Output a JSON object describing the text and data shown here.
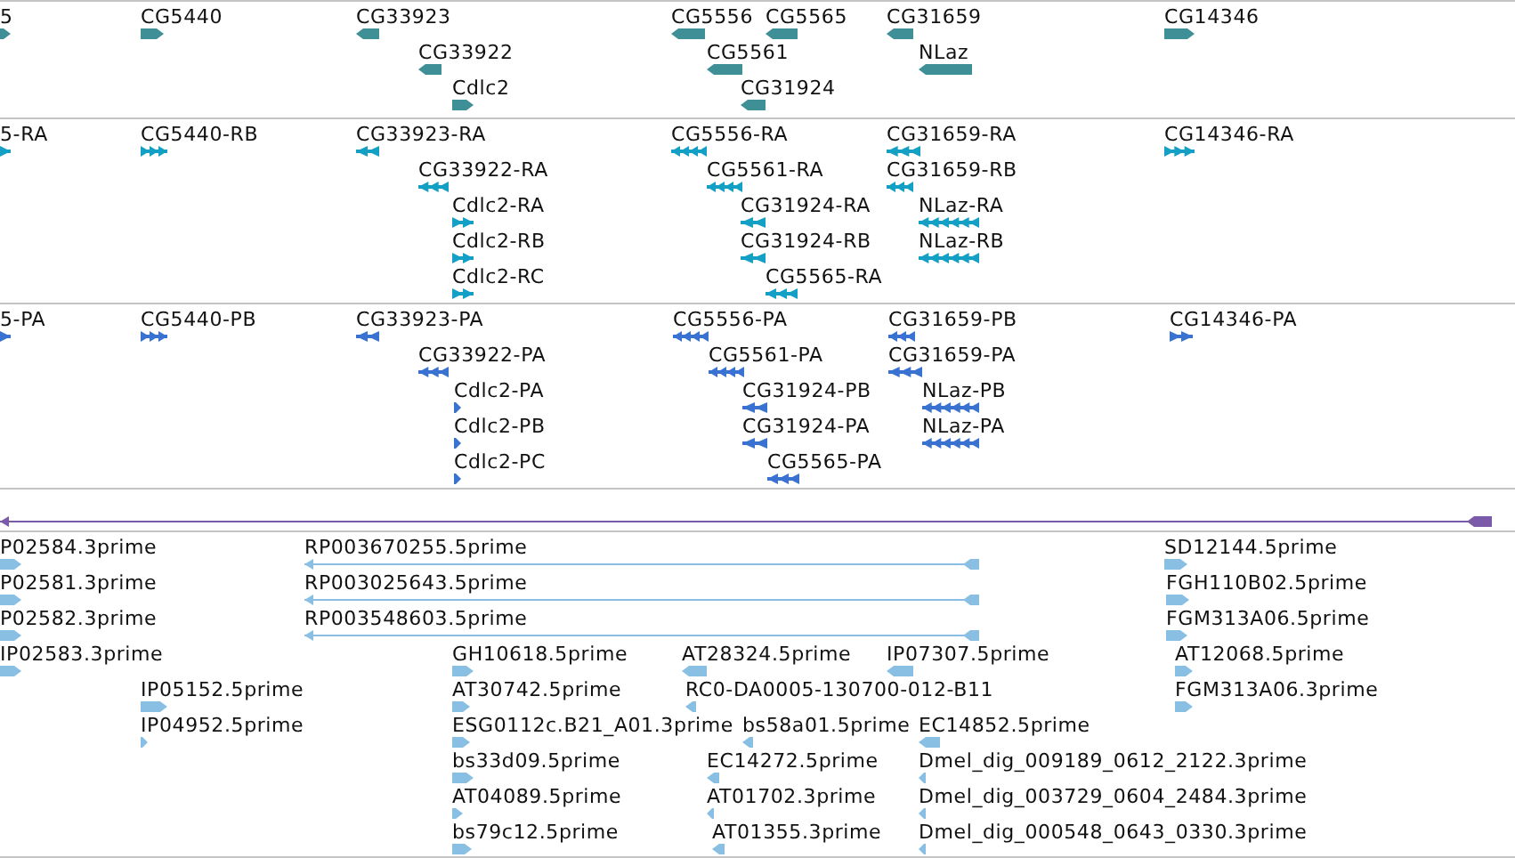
{
  "tracks": [
    {
      "kind": "gene",
      "features": [
        {
          "label": "5",
          "forward": true
        },
        {
          "label": "CG5440",
          "forward": true
        },
        {
          "label": "CG33923",
          "forward": false
        },
        {
          "label": "CG5556",
          "forward": false
        },
        {
          "label": "CG5565",
          "forward": false
        },
        {
          "label": "CG31659",
          "forward": false
        },
        {
          "label": "CG14346",
          "forward": true
        },
        {
          "label": "CG33922",
          "forward": false
        },
        {
          "label": "CG5561",
          "forward": false
        },
        {
          "label": "NLaz",
          "forward": false
        },
        {
          "label": "Cdlc2",
          "forward": true
        },
        {
          "label": "CG31924",
          "forward": false
        }
      ]
    },
    {
      "kind": "transcript",
      "features": [
        {
          "label": "5-RA",
          "forward": true
        },
        {
          "label": "CG5440-RB",
          "forward": true
        },
        {
          "label": "CG33923-RA",
          "forward": false
        },
        {
          "label": "CG5556-RA",
          "forward": false
        },
        {
          "label": "CG31659-RA",
          "forward": false
        },
        {
          "label": "CG14346-RA",
          "forward": true
        },
        {
          "label": "CG33922-RA",
          "forward": false
        },
        {
          "label": "CG5561-RA",
          "forward": false
        },
        {
          "label": "CG31659-RB",
          "forward": false
        },
        {
          "label": "Cdlc2-RA",
          "forward": true
        },
        {
          "label": "CG31924-RA",
          "forward": false
        },
        {
          "label": "NLaz-RA",
          "forward": false
        },
        {
          "label": "Cdlc2-RB",
          "forward": true
        },
        {
          "label": "CG31924-RB",
          "forward": false
        },
        {
          "label": "NLaz-RB",
          "forward": false
        },
        {
          "label": "Cdlc2-RC",
          "forward": true
        },
        {
          "label": "CG5565-RA",
          "forward": false
        }
      ]
    },
    {
      "kind": "protein",
      "features": [
        {
          "label": "5-PA",
          "forward": true
        },
        {
          "label": "CG5440-PB",
          "forward": true
        },
        {
          "label": "CG33923-PA",
          "forward": false
        },
        {
          "label": "CG5556-PA",
          "forward": false
        },
        {
          "label": "CG31659-PB",
          "forward": false
        },
        {
          "label": "CG14346-PA",
          "forward": true
        },
        {
          "label": "CG33922-PA",
          "forward": false
        },
        {
          "label": "CG5561-PA",
          "forward": false
        },
        {
          "label": "CG31659-PA",
          "forward": false
        },
        {
          "label": "Cdlc2-PA",
          "forward": true
        },
        {
          "label": "CG31924-PB",
          "forward": false
        },
        {
          "label": "NLaz-PB",
          "forward": false
        },
        {
          "label": "Cdlc2-PB",
          "forward": true
        },
        {
          "label": "CG31924-PA",
          "forward": false
        },
        {
          "label": "NLaz-PA",
          "forward": false
        },
        {
          "label": "Cdlc2-PC",
          "forward": true
        },
        {
          "label": "CG5565-PA",
          "forward": false
        }
      ]
    },
    {
      "kind": "region",
      "features": [
        {
          "forward": false
        }
      ]
    },
    {
      "kind": "est",
      "features": [
        {
          "label": "P02584.3prime",
          "forward": true
        },
        {
          "label": "RP003670255.5prime",
          "forward": false
        },
        {
          "label": "SD12144.5prime",
          "forward": true
        },
        {
          "label": "P02581.3prime",
          "forward": true
        },
        {
          "label": "RP003025643.5prime",
          "forward": false
        },
        {
          "label": "FGH110B02.5prime",
          "forward": true
        },
        {
          "label": "P02582.3prime",
          "forward": true
        },
        {
          "label": "RP003548603.5prime",
          "forward": false
        },
        {
          "label": "FGM313A06.5prime",
          "forward": true
        },
        {
          "label": "IP02583.3prime",
          "forward": true
        },
        {
          "label": "GH10618.5prime",
          "forward": true
        },
        {
          "label": "AT28324.5prime",
          "forward": false
        },
        {
          "label": "IP07307.5prime",
          "forward": false
        },
        {
          "label": "AT12068.5prime",
          "forward": true
        },
        {
          "label": "IP05152.5prime",
          "forward": true
        },
        {
          "label": "AT30742.5prime",
          "forward": true
        },
        {
          "label": "RC0-DA0005-130700-012-B11",
          "forward": false
        },
        {
          "label": "FGM313A06.3prime",
          "forward": true
        },
        {
          "label": "IP04952.5prime",
          "forward": true
        },
        {
          "label": "ESG0112c.B21_A01.3prime",
          "forward": true
        },
        {
          "label": "bs58a01.5prime",
          "forward": false
        },
        {
          "label": "EC14852.5prime",
          "forward": false
        },
        {
          "label": "bs33d09.5prime",
          "forward": true
        },
        {
          "label": "EC14272.5prime",
          "forward": false
        },
        {
          "label": "Dmel_dig_009189_0612_2122.3prime",
          "forward": false
        },
        {
          "label": "AT04089.5prime",
          "forward": true
        },
        {
          "label": "AT01702.3prime",
          "forward": false
        },
        {
          "label": "Dmel_dig_003729_0604_2484.3prime",
          "forward": false
        },
        {
          "label": "bs79c12.5prime",
          "forward": true
        },
        {
          "label": "AT01355.3prime",
          "forward": false
        },
        {
          "label": "Dmel_dig_000548_0643_0330.3prime",
          "forward": false
        }
      ]
    }
  ]
}
